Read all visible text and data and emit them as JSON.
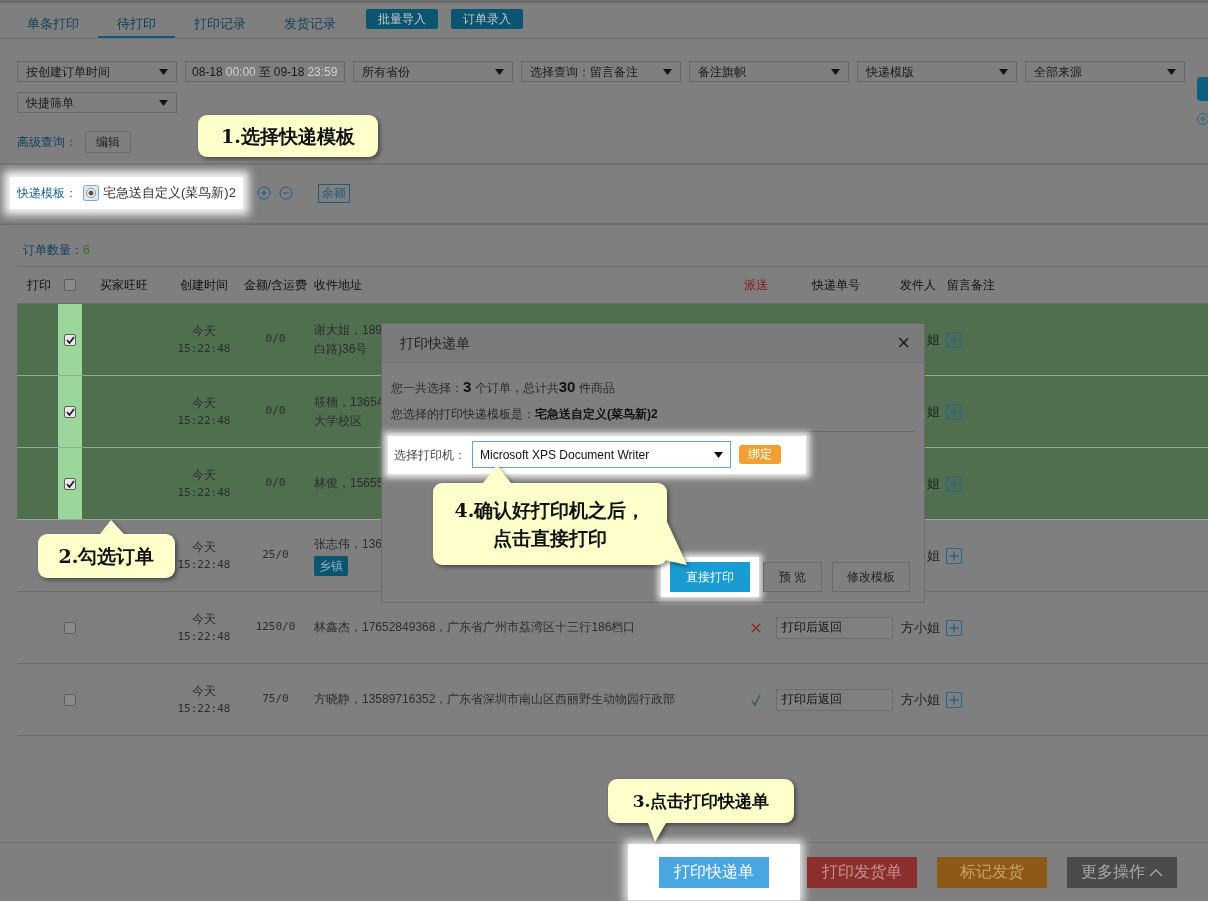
{
  "tabs": [
    {
      "label": "单条打印",
      "selected": false
    },
    {
      "label": "待打印",
      "selected": true
    },
    {
      "label": "打印记录",
      "selected": false
    },
    {
      "label": "发货记录",
      "selected": false
    }
  ],
  "top_buttons": [
    "批量导入",
    "订单录入"
  ],
  "filters": [
    {
      "kind": "select",
      "value": "按创建订单时间"
    },
    {
      "kind": "daterange",
      "start": "08-18",
      "start_time": "00:00",
      "separator": "至",
      "end": "09-18",
      "end_time": "23:59"
    },
    {
      "kind": "select",
      "value": "所有省份"
    },
    {
      "kind": "select",
      "value": "选择查询：留言备注"
    },
    {
      "kind": "select",
      "value": "备注旗帜"
    },
    {
      "kind": "select",
      "value": "快递模版"
    },
    {
      "kind": "select",
      "value": "全部来源"
    },
    {
      "kind": "select",
      "value": "快捷筛单"
    }
  ],
  "advanced_query": {
    "label": "高级查询：",
    "button": "编辑"
  },
  "template": {
    "label": "快递模板：",
    "option": "宅急送自定义(菜鸟新)2",
    "selected": true,
    "balance_button": "余额"
  },
  "order_count": {
    "label": "订单数量：",
    "value": "6"
  },
  "table": {
    "header_checked": false,
    "columns": [
      "打印",
      "买家旺旺",
      "创建时间",
      "金额/含运费",
      "收件地址",
      "派送",
      "快递单号",
      "发件人",
      "留言备注"
    ],
    "rows": [
      {
        "checked": true,
        "day": "今天",
        "time": "15:22:48",
        "amount": "0/0",
        "address": [
          "谢大姐，189",
          "白路)36号"
        ],
        "sender": "姐"
      },
      {
        "checked": true,
        "day": "今天",
        "time": "15:22:48",
        "amount": "0/0",
        "address": [
          "筱楠，13654",
          "大学校区"
        ],
        "sender": "姐"
      },
      {
        "checked": true,
        "day": "今天",
        "time": "15:22:48",
        "amount": "0/0",
        "address": [
          "林俊，15655"
        ],
        "sender": "姐"
      },
      {
        "day": "今天",
        "time": "15:22:48",
        "amount": "25/0",
        "address": [
          "张志伟，136"
        ],
        "tag": "乡镇",
        "sender": "姐"
      },
      {
        "checked": false,
        "day": "今天",
        "time": "15:22:48",
        "amount": "1250/0",
        "address": [
          "林鑫杰，17652849368，广东省广州市荔湾区十三行186档口"
        ],
        "dispatch_ok": false,
        "tracking": "打印后返回",
        "sender": "方小姐"
      },
      {
        "checked": false,
        "day": "今天",
        "time": "15:22:48",
        "amount": "75/0",
        "address": [
          "方晓静，13589716352，广东省深圳市南山区西丽野生动物园行政部"
        ],
        "dispatch_ok": true,
        "tracking": "打印后返回",
        "sender": "方小姐"
      }
    ]
  },
  "dialog": {
    "title": "打印快递单",
    "close": "×",
    "summary": "您一共选择：**3** 个订单，总计共**30** 件商品",
    "template_line": "您选择的打印快递模板是：**宅急送自定义(菜鸟新)2**",
    "printer_label": "选择打印机：",
    "printer": "Microsoft XPS Document Writer",
    "bind_button": "绑定",
    "buttons": [
      {
        "label": "直接打印",
        "kind": "primary"
      },
      {
        "label": "预 览",
        "kind": "default"
      },
      {
        "label": "修改模板",
        "kind": "default"
      }
    ]
  },
  "bottom_buttons": [
    {
      "label": "打印快递单",
      "kind": "blue"
    },
    {
      "label": "打印发货单",
      "kind": "red"
    },
    {
      "label": "标记发货",
      "kind": "orange"
    },
    {
      "label": "更多操作",
      "kind": "more"
    }
  ],
  "callouts": [
    {
      "lines": [
        "1.选择快递模板"
      ]
    },
    {
      "lines": [
        "2.勾选订单"
      ]
    },
    {
      "lines": [
        "3.点击打印快递单"
      ]
    },
    {
      "lines": [
        "4.确认好打印机之后，",
        "点击直接打印"
      ]
    }
  ]
}
